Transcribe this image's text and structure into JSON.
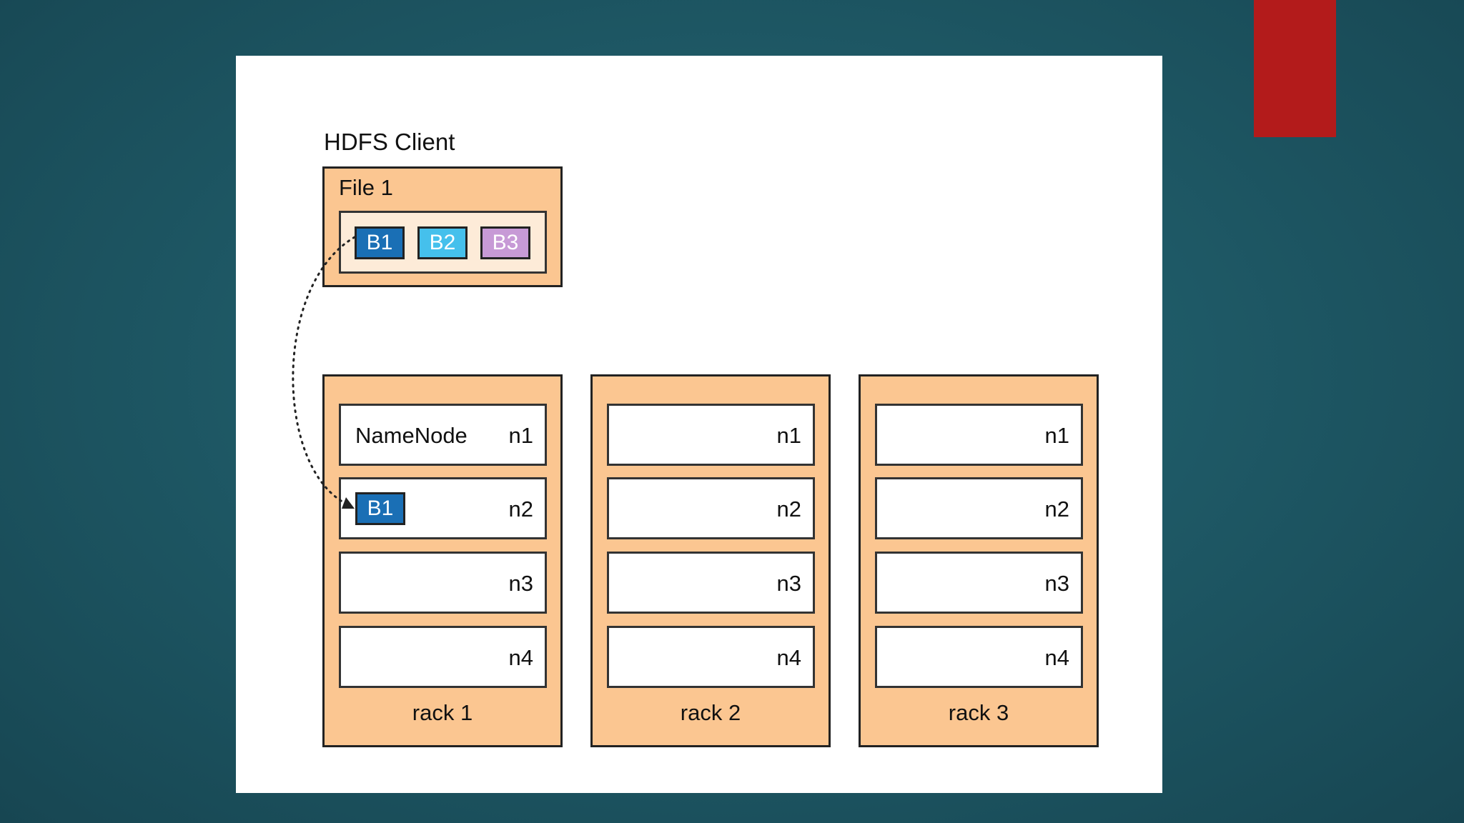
{
  "client": {
    "title": "HDFS Client",
    "file_label": "File 1",
    "blocks": [
      "B1",
      "B2",
      "B3"
    ]
  },
  "racks": [
    {
      "label": "rack 1",
      "nodes": [
        "n1",
        "n2",
        "n3",
        "n4"
      ],
      "namenode_label": "NameNode",
      "stored_block": "B1"
    },
    {
      "label": "rack 2",
      "nodes": [
        "n1",
        "n2",
        "n3",
        "n4"
      ]
    },
    {
      "label": "rack 3",
      "nodes": [
        "n1",
        "n2",
        "n3",
        "n4"
      ]
    }
  ],
  "colors": {
    "rack_fill": "#fbc691",
    "block_b1": "#1a6fb5",
    "block_b2": "#45c0ec",
    "block_b3": "#c79ad6",
    "accent_red": "#b31b1b"
  }
}
